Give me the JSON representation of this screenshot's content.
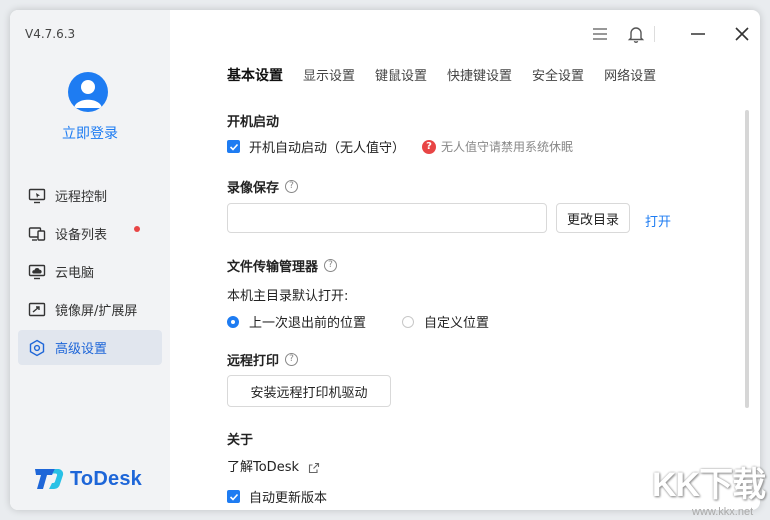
{
  "app": {
    "version": "V4.7.6.3",
    "logo_text": "ToDesk",
    "brand_color": "#1e7cf2"
  },
  "account": {
    "login_label": "立即登录"
  },
  "sidebar": {
    "items": [
      {
        "label": "远程控制",
        "icon": "remote-control-icon"
      },
      {
        "label": "设备列表",
        "icon": "device-list-icon",
        "badge": true
      },
      {
        "label": "云电脑",
        "icon": "cloud-pc-icon"
      },
      {
        "label": "镜像屏/扩展屏",
        "icon": "mirror-screen-icon"
      },
      {
        "label": "高级设置",
        "icon": "advanced-settings-icon",
        "active": true
      }
    ]
  },
  "titlebar": {
    "icons": [
      "menu-icon",
      "bell-icon",
      "minimize-icon",
      "close-icon"
    ]
  },
  "tabs": [
    "基本设置",
    "显示设置",
    "键鼠设置",
    "快捷键设置",
    "安全设置",
    "网络设置"
  ],
  "settings": {
    "startup": {
      "title": "开机启动",
      "checkbox_label": "开机自动启动（无人值守）",
      "checked": true,
      "warning": "无人值守请禁用系统休眠"
    },
    "recording": {
      "title": "录像保存",
      "path_value": "",
      "change_button": "更改目录",
      "open_link": "打开"
    },
    "file_transfer": {
      "title": "文件传输管理器",
      "subtitle": "本机主目录默认打开:",
      "options": [
        "上一次退出前的位置",
        "自定义位置"
      ],
      "selected": 0
    },
    "remote_print": {
      "title": "远程打印",
      "install_button": "安装远程打印机驱动"
    },
    "about": {
      "title": "关于",
      "link": "了解ToDesk",
      "auto_update_label": "自动更新版本",
      "auto_update_checked": true
    }
  },
  "watermark": {
    "text": "KK下载",
    "url": "www.kkx.net"
  }
}
